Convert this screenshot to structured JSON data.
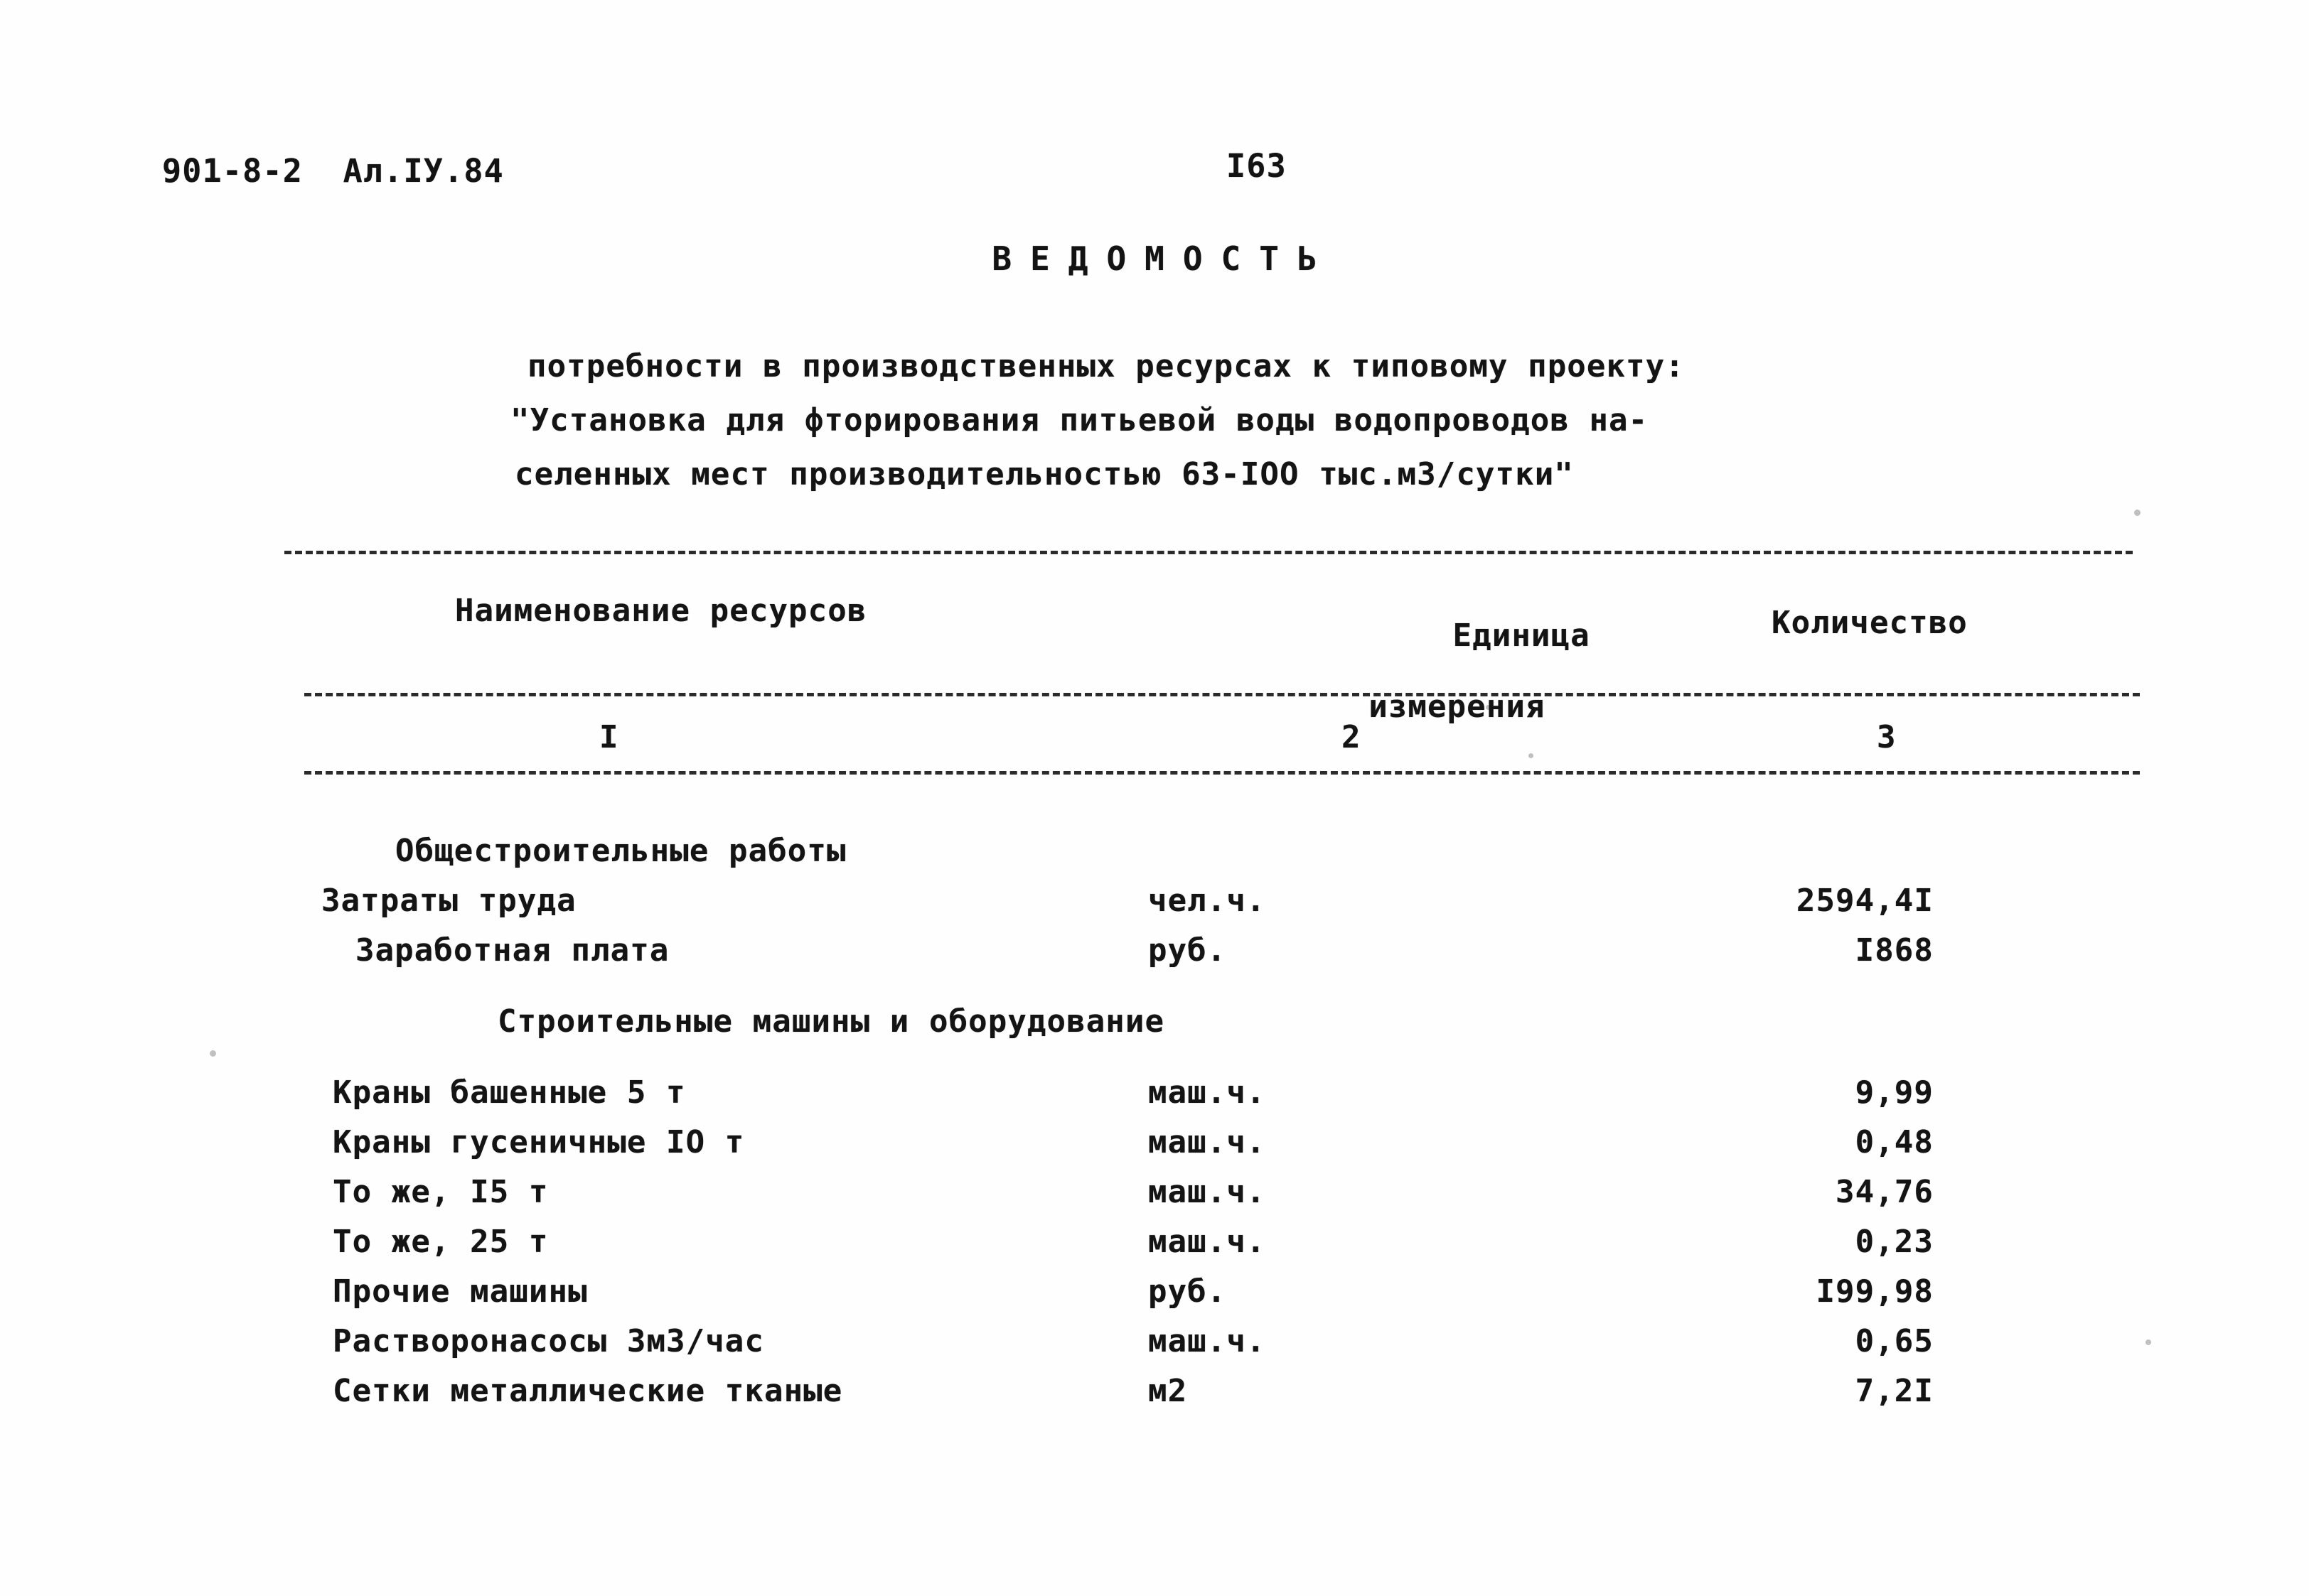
{
  "header": {
    "doc_code": "901-8-2  Ал.IУ.84",
    "page_number": "I63"
  },
  "title": "ВЕДОМОСТЬ",
  "subtitle": {
    "line1": "потребности в производственных ресурсах к типовому проекту:",
    "line2": "\"Установка для фторирования питьевой воды водопроводов на-",
    "line3": "селенных мест производительностью 63-IOO тыс.м3/сутки\""
  },
  "table": {
    "headers": {
      "name": "Наименование ресурсов",
      "unit_line1": "Единица",
      "unit_line2": "измерения",
      "quantity": "Количество"
    },
    "column_numbers": [
      "I",
      "2",
      "3"
    ],
    "rows": [
      {
        "type": "section",
        "name": "Общестроительные работы",
        "unit": "",
        "qty": ""
      },
      {
        "type": "item",
        "name": "Затраты труда",
        "unit": "чел.ч.",
        "qty": "2594,4I"
      },
      {
        "type": "indent1",
        "name": "Заработная плата",
        "unit": "руб.",
        "qty": "I868"
      },
      {
        "type": "section-2",
        "name": "Строительные машины и оборудование",
        "unit": "",
        "qty": ""
      },
      {
        "type": "indent2",
        "name": "Краны башенные 5 т",
        "unit": "маш.ч.",
        "qty": "9,99"
      },
      {
        "type": "indent2",
        "name": "Краны гусеничные IO т",
        "unit": "маш.ч.",
        "qty": "0,48"
      },
      {
        "type": "indent2",
        "name": "То же, I5 т",
        "unit": "маш.ч.",
        "qty": "34,76"
      },
      {
        "type": "indent2",
        "name": "То же, 25 т",
        "unit": "маш.ч.",
        "qty": "0,23"
      },
      {
        "type": "indent2",
        "name": "Прочие машины",
        "unit": "руб.",
        "qty": "I99,98"
      },
      {
        "type": "indent2",
        "name": "Растворонасосы 3м3/час",
        "unit": "маш.ч.",
        "qty": "0,65"
      },
      {
        "type": "indent2",
        "name": "Сетки металлические тканые",
        "unit": "м2",
        "qty": "7,2I"
      }
    ]
  },
  "colors": {
    "paper": "#fefefe",
    "ink": "#141414"
  }
}
